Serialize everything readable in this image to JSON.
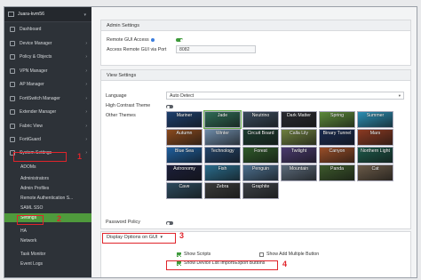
{
  "sidebar": {
    "host": "Juara-kvm56",
    "items": [
      {
        "label": "Dashboard",
        "chevron": false
      },
      {
        "label": "Device Manager",
        "chevron": true
      },
      {
        "label": "Policy & Objects",
        "chevron": true
      },
      {
        "label": "VPN Manager",
        "chevron": true
      },
      {
        "label": "AP Manager",
        "chevron": true
      },
      {
        "label": "FortiSwitch Manager",
        "chevron": true
      },
      {
        "label": "Extender Manager",
        "chevron": true
      },
      {
        "label": "Fabric View",
        "chevron": true
      },
      {
        "label": "FortiGuard",
        "chevron": true
      },
      {
        "label": "System Settings",
        "chevron": true
      }
    ],
    "sub_items": [
      {
        "label": "ADOMs",
        "active": false
      },
      {
        "label": "Administrators",
        "active": false
      },
      {
        "label": "Admin Profiles",
        "active": false
      },
      {
        "label": "Remote Authentication S...",
        "active": false
      },
      {
        "label": "SAML SSO",
        "active": false
      },
      {
        "label": "Settings",
        "active": true
      },
      {
        "label": "HA",
        "active": false
      },
      {
        "label": "Network",
        "active": false
      },
      {
        "label": "Task Monitor",
        "active": false
      },
      {
        "label": "Event Logs",
        "active": false
      }
    ]
  },
  "annotations": {
    "step1": "1",
    "step2": "2",
    "step3": "3",
    "step4": "4"
  },
  "admin": {
    "header": "Admin Settings",
    "remote_gui_access_label": "Remote GUI Access",
    "remote_gui_access_on": true,
    "remote_gui_port_label": "Access Remote GUI via Port",
    "remote_gui_port_value": "8082"
  },
  "view": {
    "header": "View Settings",
    "language_label": "Language",
    "language_value": "Auto Detect",
    "high_contrast_label": "High Contrast Theme",
    "high_contrast_on": false,
    "other_themes_label": "Other Themes",
    "themes": [
      {
        "name": "Mariner",
        "color": "#1d3f6e",
        "selected": false
      },
      {
        "name": "Jade",
        "color": "#2f6b55",
        "selected": true
      },
      {
        "name": "Neutrino",
        "color": "#3a4a5c",
        "selected": false
      },
      {
        "name": "Dark Matter",
        "color": "#2a2a31",
        "selected": false
      },
      {
        "name": "Spring",
        "color": "#5c8a3a",
        "selected": false
      },
      {
        "name": "Summer",
        "color": "#2c8fb4",
        "selected": false
      },
      {
        "name": "Autumn",
        "color": "#8a4a1e",
        "selected": false
      },
      {
        "name": "Winter",
        "color": "#6d8aa8",
        "selected": false
      },
      {
        "name": "Circuit Board",
        "color": "#1c3d2f",
        "selected": false
      },
      {
        "name": "Calla Lily",
        "color": "#6e7f3f",
        "selected": false
      },
      {
        "name": "Binary Tunnel",
        "color": "#1a2c52",
        "selected": false
      },
      {
        "name": "Mars",
        "color": "#8c3a22",
        "selected": false
      },
      {
        "name": "Blue Sea",
        "color": "#1f5f9e",
        "selected": false
      },
      {
        "name": "Technology",
        "color": "#23446a",
        "selected": false
      },
      {
        "name": "Forest",
        "color": "#2f5a2a",
        "selected": false
      },
      {
        "name": "Twilight",
        "color": "#4a3a6e",
        "selected": false
      },
      {
        "name": "Canyon",
        "color": "#9a4e28",
        "selected": false
      },
      {
        "name": "Northern Light",
        "color": "#1d5a4a",
        "selected": false
      },
      {
        "name": "Astronomy",
        "color": "#1b1f3a",
        "selected": false
      },
      {
        "name": "Fish",
        "color": "#2a6c8c",
        "selected": false
      },
      {
        "name": "Penguin",
        "color": "#4c6f8e",
        "selected": false
      },
      {
        "name": "Mountain",
        "color": "#5b6a7a",
        "selected": false
      },
      {
        "name": "Panda",
        "color": "#3d5a2c",
        "selected": false
      },
      {
        "name": "Cat",
        "color": "#6a5a48",
        "selected": false
      },
      {
        "name": "Cave",
        "color": "#2c4a5e",
        "selected": false
      },
      {
        "name": "Zebra",
        "color": "#3a3a3a",
        "selected": false
      },
      {
        "name": "Graphite",
        "color": "#3c4046",
        "selected": false
      }
    ],
    "password_policy_label": "Password Policy",
    "password_policy_on": false
  },
  "display": {
    "header": "Display Options on GUI",
    "show_scripts_label": "Show Scripts",
    "show_scripts_checked": true,
    "show_add_multiple_label": "Show Add Multiple Button",
    "show_add_multiple_checked": false,
    "show_import_export_label": "Show Device List Import/Export Buttons",
    "show_import_export_checked": true
  }
}
